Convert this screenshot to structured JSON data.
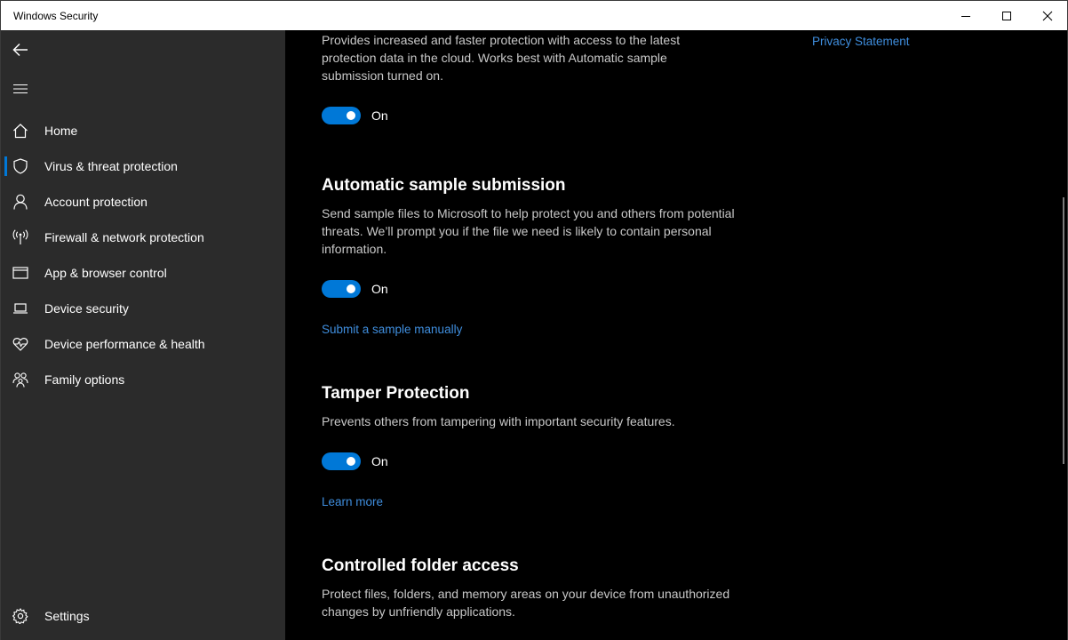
{
  "window": {
    "title": "Windows Security"
  },
  "sidebar": {
    "items": [
      {
        "label": "Home",
        "icon": "home-icon"
      },
      {
        "label": "Virus & threat protection",
        "icon": "shield-icon",
        "active": true
      },
      {
        "label": "Account protection",
        "icon": "person-icon"
      },
      {
        "label": "Firewall & network protection",
        "icon": "antenna-icon"
      },
      {
        "label": "App & browser control",
        "icon": "browser-window-icon"
      },
      {
        "label": "Device security",
        "icon": "laptop-icon"
      },
      {
        "label": "Device performance & health",
        "icon": "heart-pulse-icon"
      },
      {
        "label": "Family options",
        "icon": "family-icon"
      }
    ],
    "settings_label": "Settings"
  },
  "main": {
    "privacy_link": "Privacy Statement",
    "cloud": {
      "description": "Provides increased and faster protection with access to the latest protection data in the cloud. Works best with Automatic sample submission turned on.",
      "toggle_state": "On"
    },
    "sample": {
      "heading": "Automatic sample submission",
      "description": "Send sample files to Microsoft to help protect you and others from potential threats. We’ll prompt you if the file we need is likely to contain personal information.",
      "toggle_state": "On",
      "link": "Submit a sample manually"
    },
    "tamper": {
      "heading": "Tamper Protection",
      "description": "Prevents others from tampering with important security features.",
      "toggle_state": "On",
      "link": "Learn more"
    },
    "cfa": {
      "heading": "Controlled folder access",
      "description": "Protect files, folders, and memory areas on your device from unauthorized changes by unfriendly applications."
    }
  },
  "colors": {
    "accent": "#0078d7",
    "link": "#3f8ede",
    "sidebar_bg": "#2b2b2b",
    "main_bg": "#000000"
  }
}
